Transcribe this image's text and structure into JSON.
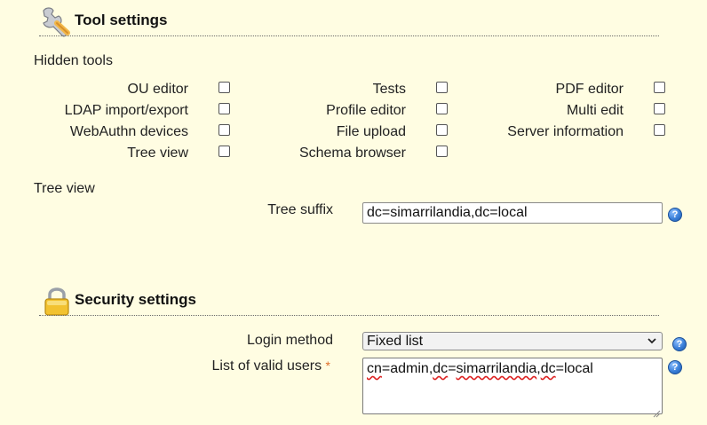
{
  "tool_settings": {
    "title": "Tool settings",
    "icon": "wrench-icon",
    "hidden_tools_label": "Hidden tools",
    "tools": [
      {
        "label": "OU editor",
        "checked": false
      },
      {
        "label": "LDAP import/export",
        "checked": false
      },
      {
        "label": "WebAuthn devices",
        "checked": false
      },
      {
        "label": "Tree view",
        "checked": false
      },
      {
        "label": "Tests",
        "checked": false
      },
      {
        "label": "Profile editor",
        "checked": false
      },
      {
        "label": "File upload",
        "checked": false
      },
      {
        "label": "Schema browser",
        "checked": false
      },
      {
        "label": "PDF editor",
        "checked": false
      },
      {
        "label": "Multi edit",
        "checked": false
      },
      {
        "label": "Server information",
        "checked": false
      }
    ],
    "tree_view_label": "Tree view",
    "tree_suffix_label": "Tree suffix",
    "tree_suffix_value": "dc=simarrilandia,dc=local"
  },
  "security_settings": {
    "title": "Security settings",
    "icon": "padlock-icon",
    "login_method_label": "Login method",
    "login_method_value": "Fixed list",
    "valid_users_label": "List of valid users",
    "required_marker": "*",
    "valid_users_value_parts": [
      "cn",
      "=admin,",
      "dc",
      "=",
      "simarrilandia",
      ",",
      "dc",
      "=local"
    ]
  },
  "colors": {
    "background": "#fffde2",
    "help_icon": "#3a7fd8",
    "required_marker": "#e0702a"
  }
}
